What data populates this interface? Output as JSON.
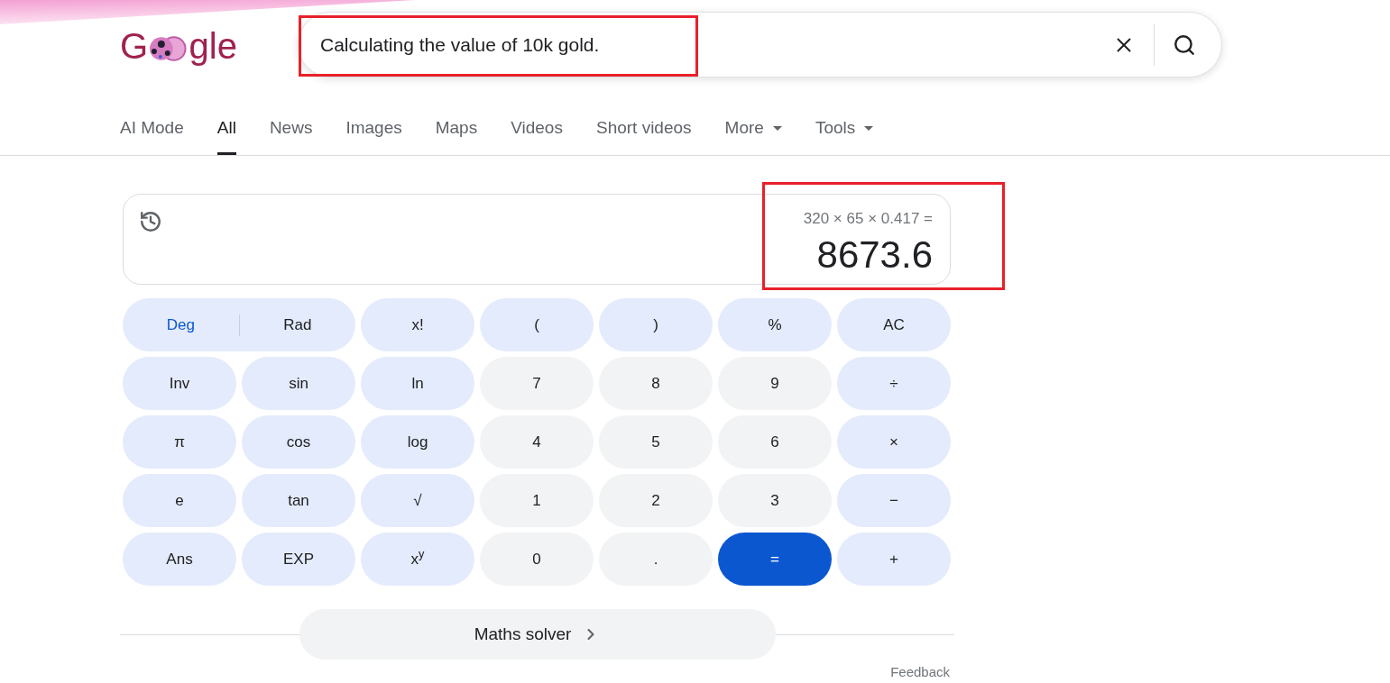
{
  "logo": {
    "lead": "G",
    "tail": "gle"
  },
  "search": {
    "value": "Calculating the value of 10k gold."
  },
  "tabs": [
    {
      "label": "AI Mode",
      "selected": false,
      "kind": "link"
    },
    {
      "label": "All",
      "selected": true,
      "kind": "link"
    },
    {
      "label": "News",
      "selected": false,
      "kind": "link"
    },
    {
      "label": "Images",
      "selected": false,
      "kind": "link"
    },
    {
      "label": "Maps",
      "selected": false,
      "kind": "link"
    },
    {
      "label": "Videos",
      "selected": false,
      "kind": "link"
    },
    {
      "label": "Short videos",
      "selected": false,
      "kind": "link"
    },
    {
      "label": "More",
      "selected": false,
      "kind": "menu"
    },
    {
      "label": "Tools",
      "selected": false,
      "kind": "menu"
    }
  ],
  "calculator": {
    "expression": "320 × 65 × 0.417 =",
    "result": "8673.6",
    "keys": [
      {
        "kind": "toggle",
        "options": [
          {
            "label": "Deg",
            "selected": true
          },
          {
            "label": "Rad",
            "selected": false
          }
        ]
      },
      {
        "kind": "function",
        "label": "x!"
      },
      {
        "kind": "function",
        "label": "("
      },
      {
        "kind": "function",
        "label": ")"
      },
      {
        "kind": "function",
        "label": "%"
      },
      {
        "kind": "function",
        "label": "AC"
      },
      {
        "kind": "function",
        "label": "Inv"
      },
      {
        "kind": "function",
        "label": "sin"
      },
      {
        "kind": "function",
        "label": "ln"
      },
      {
        "kind": "digit",
        "label": "7"
      },
      {
        "kind": "digit",
        "label": "8"
      },
      {
        "kind": "digit",
        "label": "9"
      },
      {
        "kind": "function",
        "label": "÷"
      },
      {
        "kind": "function",
        "label": "π"
      },
      {
        "kind": "function",
        "label": "cos"
      },
      {
        "kind": "function",
        "label": "log"
      },
      {
        "kind": "digit",
        "label": "4"
      },
      {
        "kind": "digit",
        "label": "5"
      },
      {
        "kind": "digit",
        "label": "6"
      },
      {
        "kind": "function",
        "label": "×"
      },
      {
        "kind": "function",
        "label": "e"
      },
      {
        "kind": "function",
        "label": "tan"
      },
      {
        "kind": "function",
        "label": "√"
      },
      {
        "kind": "digit",
        "label": "1"
      },
      {
        "kind": "digit",
        "label": "2"
      },
      {
        "kind": "digit",
        "label": "3"
      },
      {
        "kind": "function",
        "label": "−"
      },
      {
        "kind": "function",
        "label": "Ans"
      },
      {
        "kind": "function",
        "label": "EXP"
      },
      {
        "kind": "function",
        "label": "x$^{y}$"
      },
      {
        "kind": "digit",
        "label": "0"
      },
      {
        "kind": "digit",
        "label": "."
      },
      {
        "kind": "equals",
        "label": "="
      },
      {
        "kind": "function",
        "label": "+"
      }
    ]
  },
  "solver": {
    "label": "Maths solver"
  },
  "feedback": "Feedback"
}
